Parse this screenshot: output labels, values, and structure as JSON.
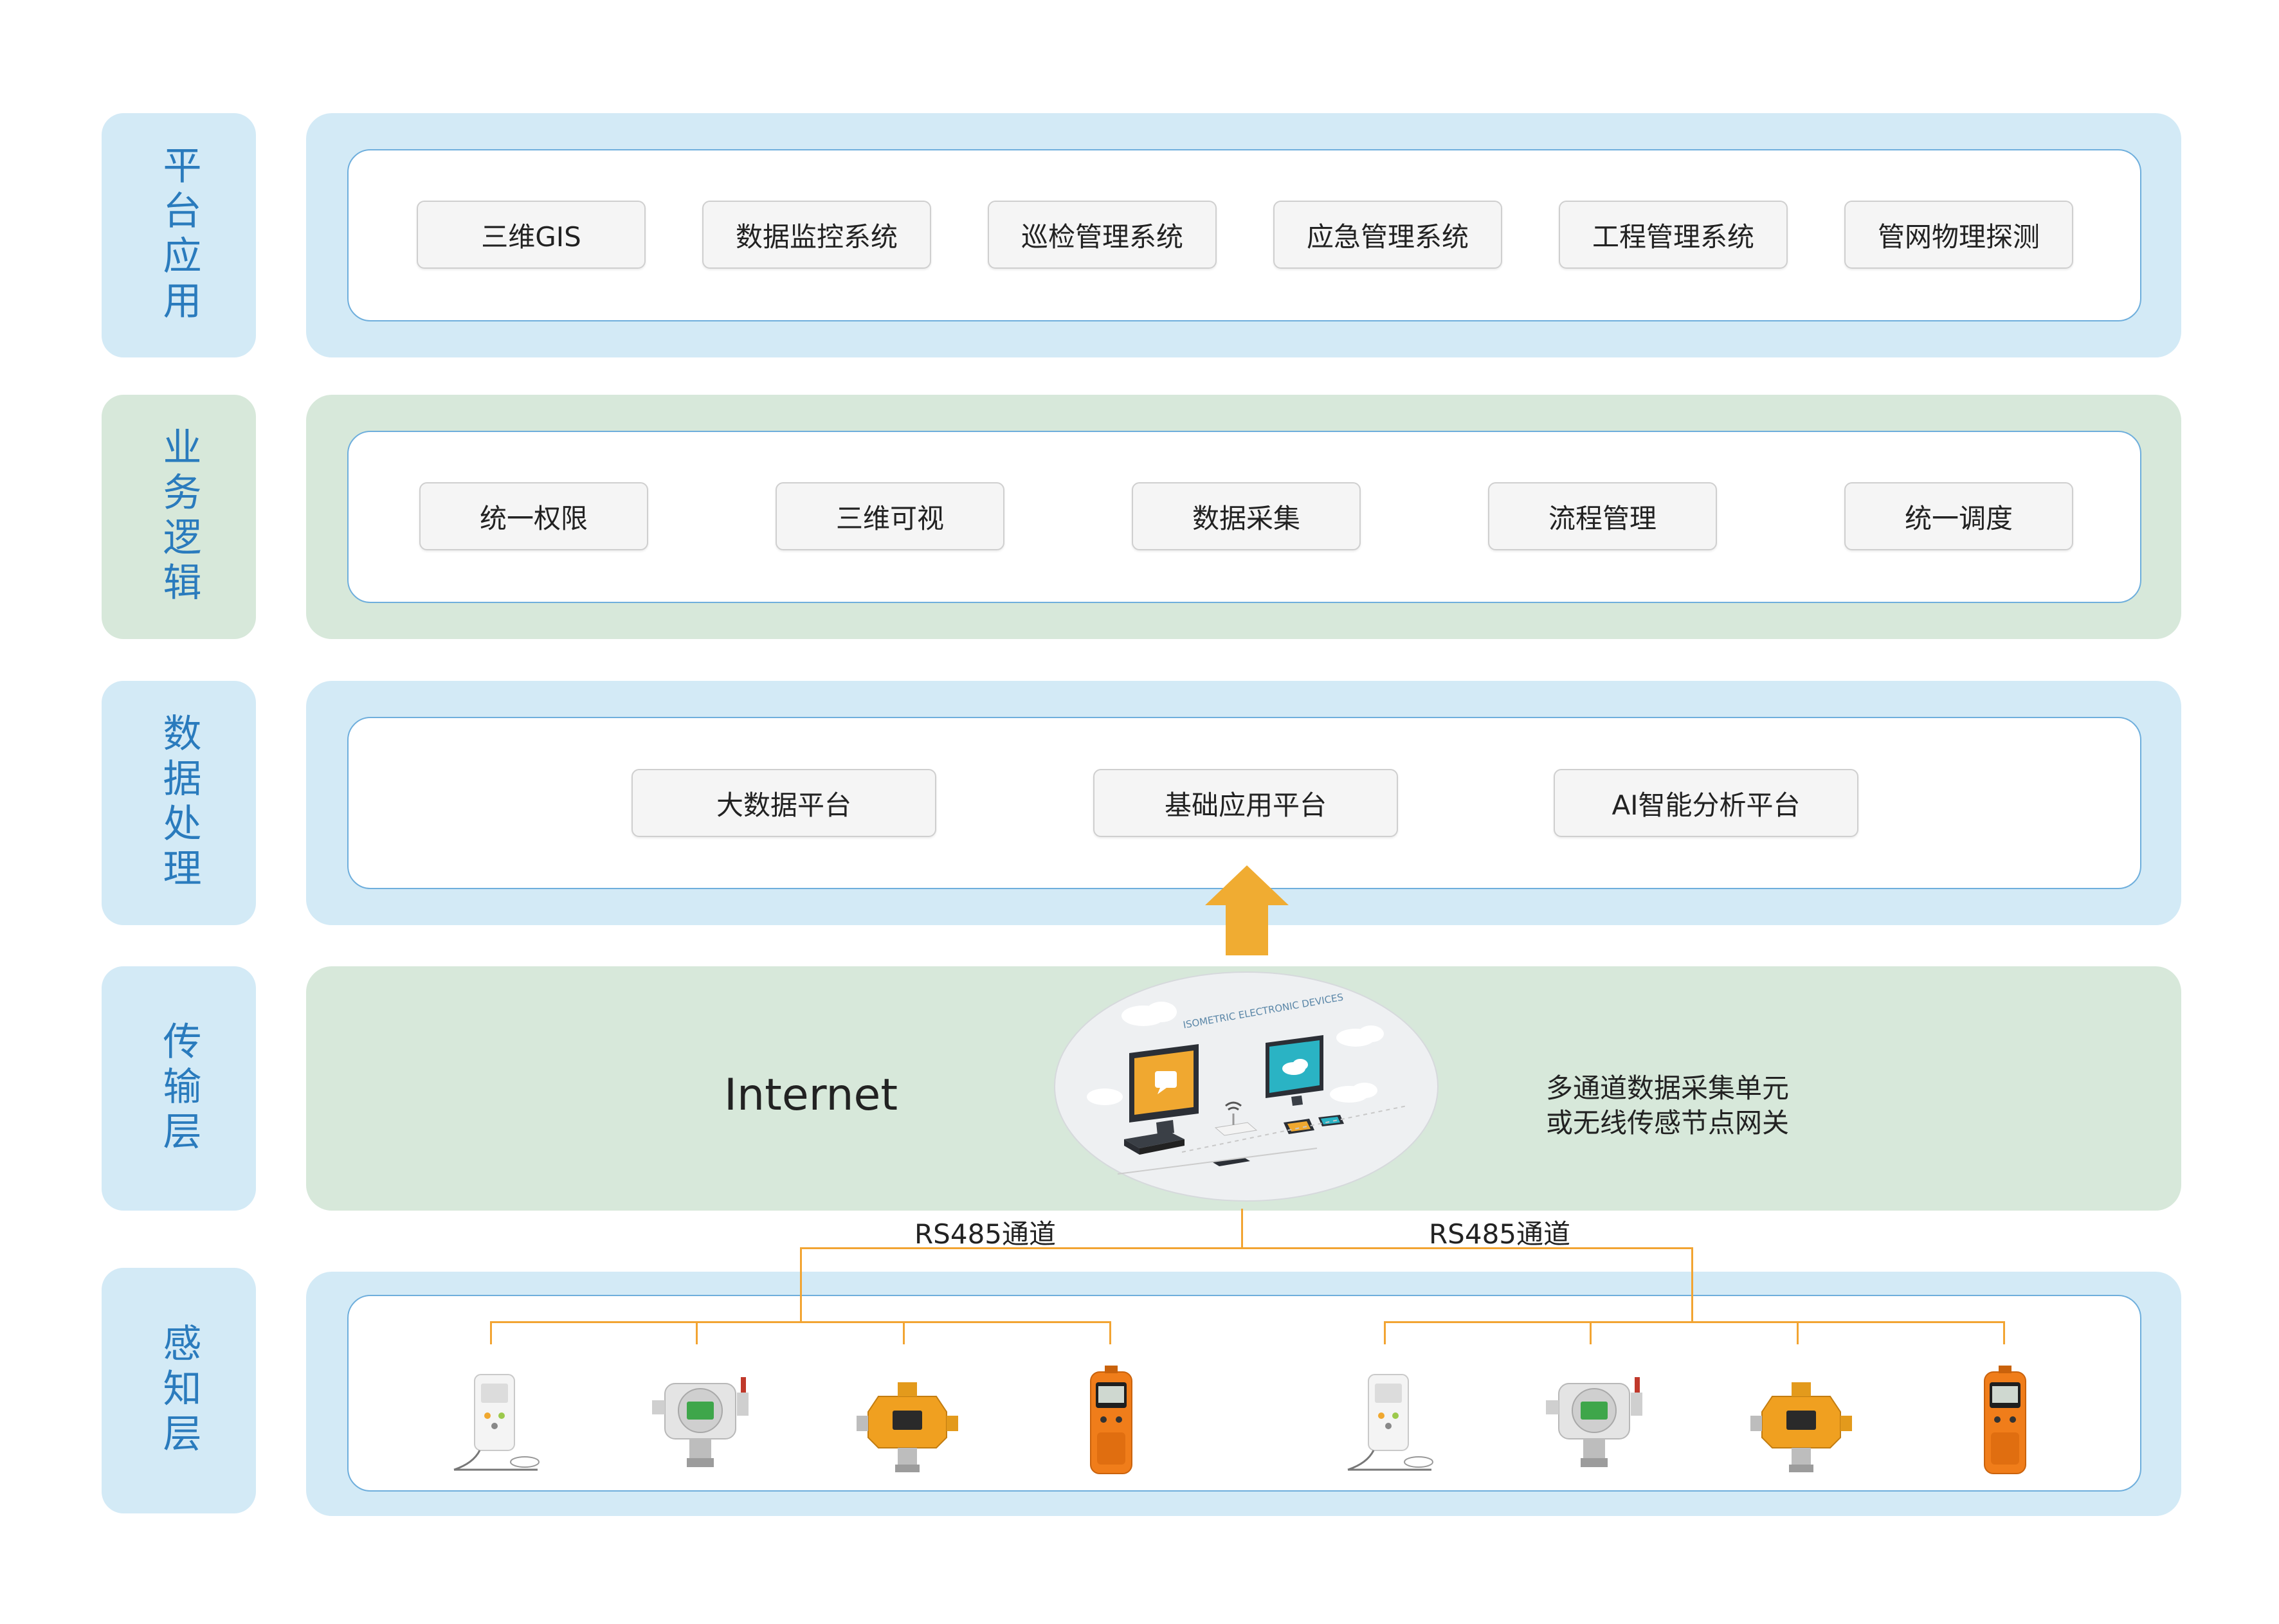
{
  "layers": [
    {
      "label": "平台应用",
      "modules": [
        "三维GIS",
        "数据监控系统",
        "巡检管理系统",
        "应急管理系统",
        "工程管理系统",
        "管网物理探测"
      ]
    },
    {
      "label": "业务逻辑",
      "modules": [
        "统一权限",
        "三维可视",
        "数据采集",
        "流程管理",
        "统一调度"
      ]
    },
    {
      "label": "数据处理",
      "modules": [
        "大数据平台",
        "基础应用平台",
        "AI智能分析平台"
      ]
    },
    {
      "label": "传输层"
    },
    {
      "label": "感知层"
    }
  ],
  "transport": {
    "internet": "Internet",
    "gateway_line1": "多通道数据采集单元",
    "gateway_line2": "或无线传感节点网关",
    "device_caption": "ISOMETRIC ELECTRONIC DEVICES"
  },
  "channels": {
    "left": "RS485通道",
    "right": "RS485通道"
  },
  "colors": {
    "blue_band": "#d3eaf6",
    "green_band": "#d7e8da",
    "label_text": "#2a7bbd",
    "connector": "#f2a432",
    "arrow": "#f0ac32"
  },
  "sensor_icons": [
    "handheld-detector-white-icon",
    "fixed-gas-detector-icon",
    "explosion-proof-detector-icon",
    "portable-gas-detector-orange-icon"
  ]
}
